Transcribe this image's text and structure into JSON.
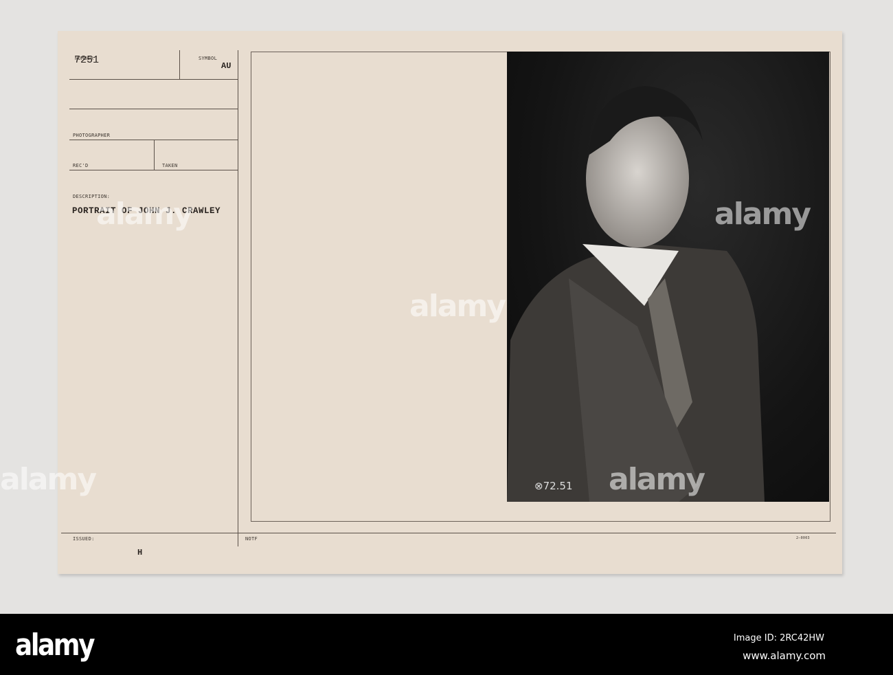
{
  "card": {
    "number_label": "NUMBER",
    "number": "7251",
    "symbol_label": "SYMBOL",
    "symbol": "AU",
    "photographer_label": "PHOTOGRAPHER",
    "recd_label": "REC'D",
    "taken_label": "TAKEN",
    "description_label": "DESCRIPTION:",
    "description": "PORTRAIT OF JOHN J. CRAWLEY",
    "issued_label": "ISSUED:",
    "issued_mark": "H",
    "notf_label": "NOTF",
    "form_code": "2—0003"
  },
  "photo": {
    "caption": "⊗72.51"
  },
  "watermark": {
    "text": "alamy"
  },
  "footer": {
    "logo": "alamy",
    "image_id": "Image ID: 2RC42HW",
    "url": "www.alamy.com"
  }
}
